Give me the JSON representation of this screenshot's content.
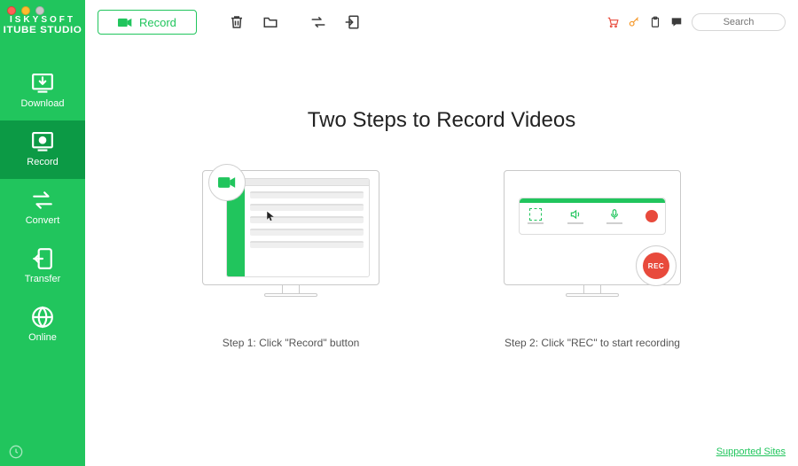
{
  "app": {
    "logo_top": "ISKYSOFT",
    "logo_bottom": "ITUBE STUDIO"
  },
  "sidebar": {
    "items": [
      {
        "label": "Download",
        "name": "download",
        "icon": "download-icon"
      },
      {
        "label": "Record",
        "name": "record",
        "icon": "record-icon",
        "active": true
      },
      {
        "label": "Convert",
        "name": "convert",
        "icon": "convert-icon"
      },
      {
        "label": "Transfer",
        "name": "transfer",
        "icon": "transfer-icon"
      },
      {
        "label": "Online",
        "name": "online",
        "icon": "globe-icon"
      }
    ]
  },
  "toolbar": {
    "record_button_label": "Record",
    "search_placeholder": "Search"
  },
  "page": {
    "title": "Two Steps to Record Videos",
    "step1_label": "Step 1: Click \"Record\" button",
    "step2_label": "Step 2: Click \"REC\" to start recording",
    "rec_bubble_text": "REC",
    "footer_link": "Supported Sites"
  },
  "colors": {
    "brand_green": "#21c55d",
    "brand_green_dark": "#0c9a45",
    "accent_red": "#e84a3c",
    "accent_orange": "#f59523"
  }
}
